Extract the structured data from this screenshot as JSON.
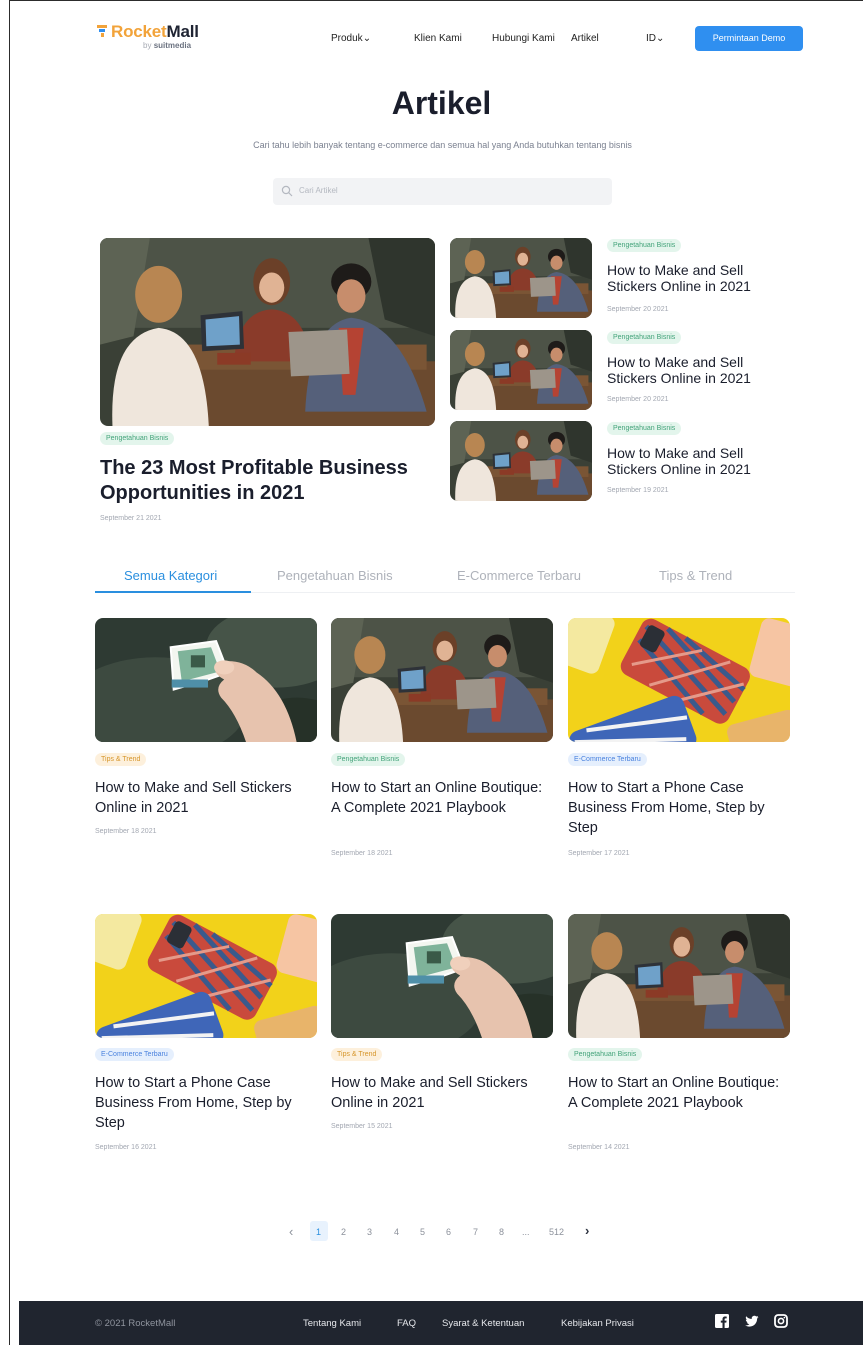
{
  "brand": {
    "name_part1": "Rocket",
    "name_part2": "Mall",
    "byline_prefix": "by",
    "byline_company": "suitmedia",
    "accent": "#f2a33a"
  },
  "nav": {
    "items": [
      {
        "label": "Produk",
        "has_dropdown": true
      },
      {
        "label": "Klien Kami"
      },
      {
        "label": "Hubungi Kami"
      },
      {
        "label": "Artikel"
      }
    ],
    "language": "ID",
    "cta_label": "Permintaan Demo",
    "cta_color": "#2f8ff0"
  },
  "hero": {
    "title": "Artikel",
    "subtitle": "Cari tahu lebih banyak tentang e-commerce dan semua hal yang Anda butuhkan tentang bisnis",
    "search_placeholder": "Cari Artikel"
  },
  "featured": {
    "main": {
      "category": "Pengetahuan Bisnis",
      "title": "The 23 Most Profitable Business Opportunities in 2021",
      "date": "September 21 2021",
      "image": "people-laptops-cafe"
    },
    "side": [
      {
        "category": "Pengetahuan Bisnis",
        "title": "How to Make and Sell Stickers Online in 2021",
        "date": "September 20 2021",
        "image": "people-laptops-cafe"
      },
      {
        "category": "Pengetahuan Bisnis",
        "title": "How to Make and Sell Stickers Online in 2021",
        "date": "September 20 2021",
        "image": "people-laptops-cafe"
      },
      {
        "category": "Pengetahuan Bisnis",
        "title": "How to Make and Sell Stickers Online in 2021",
        "date": "September 19 2021",
        "image": "people-laptops-cafe"
      }
    ]
  },
  "tabs": [
    {
      "label": "Semua Kategori",
      "active": true
    },
    {
      "label": "Pengetahuan Bisnis",
      "active": false
    },
    {
      "label": "E-Commerce Terbaru",
      "active": false
    },
    {
      "label": "Tips & Trend",
      "active": false
    }
  ],
  "articles": [
    {
      "category": "Tips & Trend",
      "category_style": "orange",
      "title": "How to Make and Sell Stickers Online in 2021",
      "date": "September 18 2021",
      "image": "hand-holding-sticker"
    },
    {
      "category": "Pengetahuan Bisnis",
      "category_style": "green",
      "title": "How to Start an Online Boutique: A Complete 2021 Playbook",
      "date": "September 18 2021",
      "image": "people-laptops-cafe"
    },
    {
      "category": "E-Commerce Terbaru",
      "category_style": "blue",
      "title": "How to Start a Phone Case Business From Home, Step by Step",
      "date": "September 17 2021",
      "image": "phone-cases-yellow"
    },
    {
      "category": "E-Commerce Terbaru",
      "category_style": "blue",
      "title": "How to Start a Phone Case Business From Home, Step by Step",
      "date": "September 16 2021",
      "image": "phone-cases-yellow"
    },
    {
      "category": "Tips & Trend",
      "category_style": "orange",
      "title": "How to Make and Sell Stickers Online in 2021",
      "date": "September 15 2021",
      "image": "hand-holding-sticker"
    },
    {
      "category": "Pengetahuan Bisnis",
      "category_style": "green",
      "title": "How to Start an Online Boutique: A Complete 2021 Playbook",
      "date": "September 14 2021",
      "image": "people-laptops-cafe"
    }
  ],
  "pagination": {
    "prev_icon": "chevron-left-icon",
    "next_icon": "chevron-right-icon",
    "pages": [
      "1",
      "2",
      "3",
      "4",
      "5",
      "6",
      "7",
      "8",
      "...",
      "512"
    ],
    "current": "1"
  },
  "footer": {
    "copyright": "© 2021 RocketMall",
    "links": [
      "Tentang Kami",
      "FAQ",
      "Syarat & Ketentuan",
      "Kebijakan Privasi"
    ],
    "social": [
      "facebook-icon",
      "twitter-icon",
      "instagram-icon"
    ],
    "background": "#20252f"
  }
}
